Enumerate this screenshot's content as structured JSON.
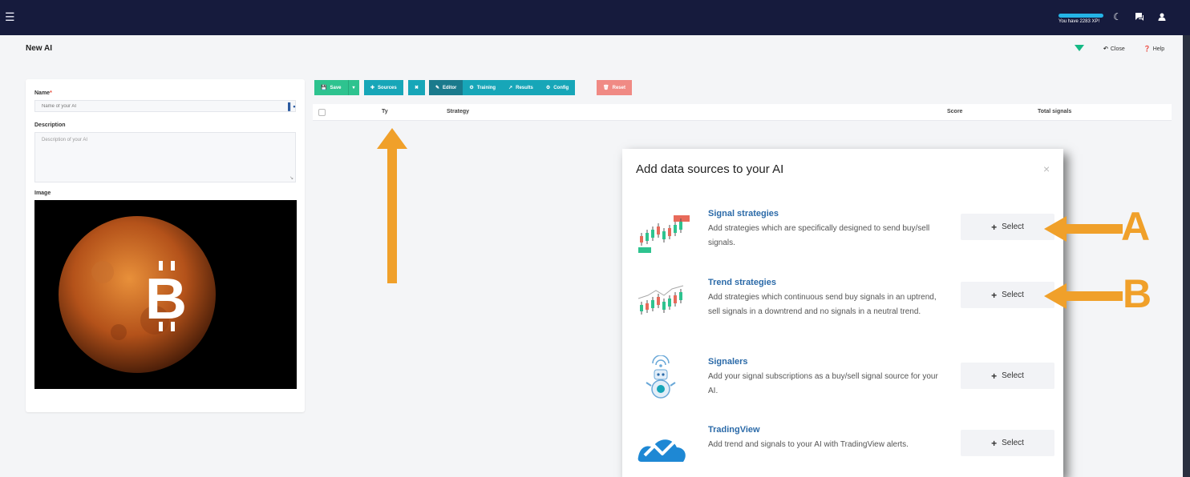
{
  "topbar": {
    "menu_icon": "hamburger-icon",
    "xp_text": "You have 2283 XP!",
    "icons": [
      "moon-icon",
      "chat-icon",
      "user-icon"
    ]
  },
  "page": {
    "title": "New AI",
    "close_label": "Close",
    "help_label": "Help"
  },
  "form": {
    "name_label": "Name",
    "name_required": "*",
    "name_placeholder": "Name of your AI",
    "description_label": "Description",
    "description_placeholder": "Description of your AI",
    "image_label": "Image",
    "image_symbol": "B"
  },
  "toolbar": {
    "save": "Save",
    "sources": "Sources",
    "editor": "Editor",
    "training": "Training",
    "results": "Results",
    "config": "Config",
    "reset": "Reset"
  },
  "table": {
    "columns": [
      "Ty",
      "Strategy",
      "Score",
      "Total signals"
    ]
  },
  "modal": {
    "title": "Add data sources to your AI",
    "close": "×",
    "sources": [
      {
        "title": "Signal strategies",
        "desc": "Add strategies which are specifically designed to send buy/sell signals.",
        "button": "Select",
        "icon": "signal-chart-icon"
      },
      {
        "title": "Trend strategies",
        "desc": "Add strategies which continuous send buy signals in an uptrend, sell signals in a downtrend and no signals in a neutral trend.",
        "button": "Select",
        "icon": "trend-chart-icon"
      },
      {
        "title": "Signalers",
        "desc": "Add your signal subscriptions as a buy/sell signal source for your AI.",
        "button": "Select",
        "icon": "robot-icon"
      },
      {
        "title": "TradingView",
        "desc": "Add trend and signals to your AI with TradingView alerts.",
        "button": "Select",
        "icon": "tradingview-icon"
      }
    ]
  },
  "annotations": {
    "a": "A",
    "b": "B"
  },
  "colors": {
    "topbar": "#161b3d",
    "accent_green": "#2ec38f",
    "accent_teal": "#17a6b8",
    "accent_dark_teal": "#1a7a8c",
    "reset_red": "#f08a84",
    "annotation_orange": "#f0a02a",
    "source_title_blue": "#2b6aa8"
  }
}
